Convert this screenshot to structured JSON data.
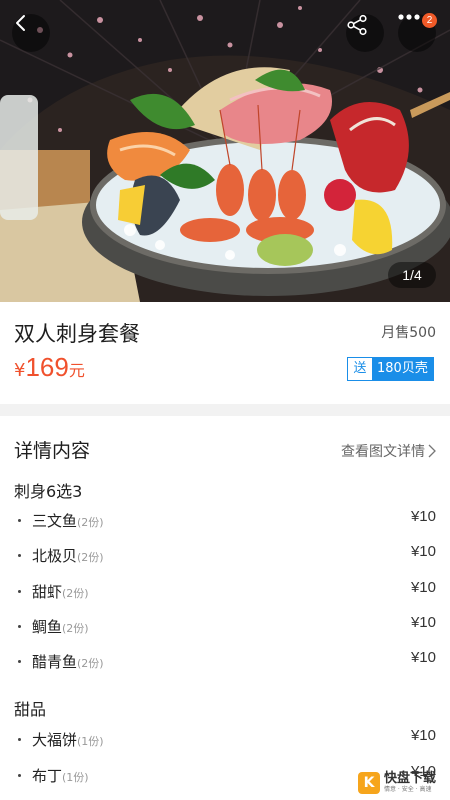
{
  "hero": {
    "counter": "1/4",
    "notification_count": "2",
    "icons": [
      "back-arrow-icon",
      "share-icon",
      "more-icon"
    ]
  },
  "product": {
    "title": "双人刺身套餐",
    "monthly_sales": "月售500",
    "price_currency": "¥",
    "price_value": "169",
    "price_unit": "元",
    "gift_tag": "送",
    "gift_value": "180贝壳"
  },
  "details": {
    "heading": "详情内容",
    "link_label": "查看图文详情",
    "groups": [
      {
        "title": "刺身6选3",
        "items": [
          {
            "name": "三文鱼",
            "qty": "(2份)",
            "price": "¥10"
          },
          {
            "name": "北极贝",
            "qty": "(2份)",
            "price": "¥10"
          },
          {
            "name": "甜虾",
            "qty": "(2份)",
            "price": "¥10"
          },
          {
            "name": "鲷鱼",
            "qty": "(2份)",
            "price": "¥10"
          },
          {
            "name": "醋青鱼",
            "qty": "(2份)",
            "price": "¥10"
          }
        ]
      },
      {
        "title": "甜品",
        "items": [
          {
            "name": "大福饼",
            "qty": "(1份)",
            "price": "¥10"
          },
          {
            "name": "布丁",
            "qty": "(1份)",
            "price": "¥10"
          }
        ]
      }
    ]
  },
  "watermark": {
    "logo_char": "K",
    "main": "快盘下载",
    "sub": "情意 · 安全 · 高速"
  },
  "colors": {
    "price": "#f0512d",
    "gift": "#1a8ee8",
    "badge": "#f05a28"
  }
}
